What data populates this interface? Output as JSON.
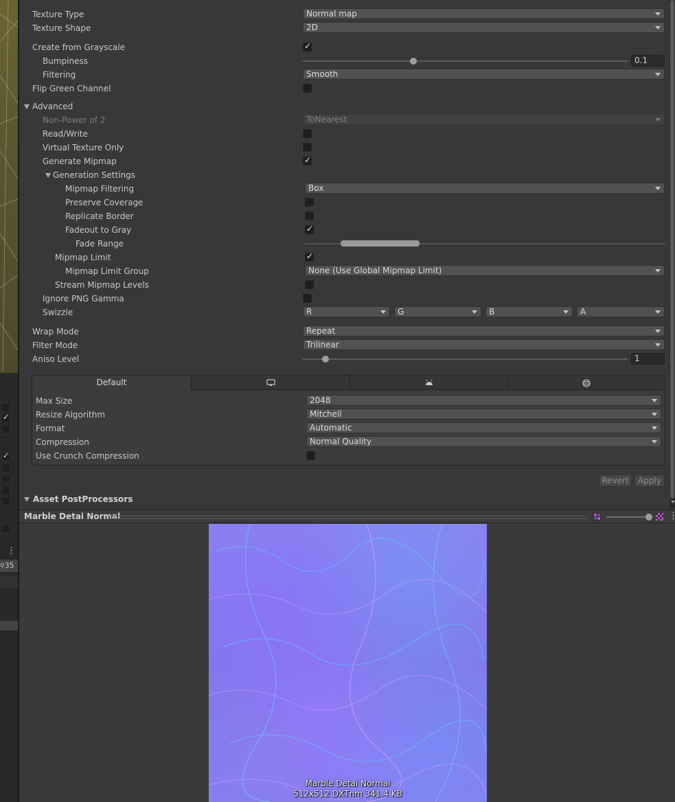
{
  "left_strip": {
    "toggles": [
      false,
      true,
      false,
      true,
      false,
      false,
      false,
      false,
      false
    ],
    "menu_icon": "kebab-menu-icon",
    "counter": "35"
  },
  "inspector": {
    "texture_type": {
      "label": "Texture Type",
      "value": "Normal map"
    },
    "texture_shape": {
      "label": "Texture Shape",
      "value": "2D"
    },
    "create_from_grayscale": {
      "label": "Create from Grayscale",
      "checked": true
    },
    "bumpiness": {
      "label": "Bumpiness",
      "value": "0.1",
      "fraction": 0.34
    },
    "filtering": {
      "label": "Filtering",
      "value": "Smooth"
    },
    "flip_green": {
      "label": "Flip Green Channel",
      "checked": false
    },
    "advanced": {
      "label": "Advanced",
      "non_power_of_2": {
        "label": "Non-Power of 2",
        "value": "ToNearest"
      },
      "read_write": {
        "label": "Read/Write",
        "checked": false
      },
      "virtual_texture_only": {
        "label": "Virtual Texture Only",
        "checked": false
      },
      "generate_mipmap": {
        "label": "Generate Mipmap",
        "checked": true
      },
      "generation_settings": {
        "label": "Generation Settings",
        "mipmap_filtering": {
          "label": "Mipmap Filtering",
          "value": "Box"
        },
        "preserve_coverage": {
          "label": "Preserve Coverage",
          "checked": false
        },
        "replicate_border": {
          "label": "Replicate Border",
          "checked": false
        },
        "fadeout_to_gray": {
          "label": "Fadeout to Gray",
          "checked": true
        },
        "fade_range": {
          "label": "Fade Range",
          "min_fraction": 0.1,
          "max_fraction": 0.32
        }
      },
      "mipmap_limit": {
        "label": "Mipmap Limit",
        "checked": true
      },
      "mipmap_limit_group": {
        "label": "Mipmap Limit Group",
        "value": "None (Use Global Mipmap Limit)"
      },
      "stream_mipmap_levels": {
        "label": "Stream Mipmap Levels",
        "checked": false
      },
      "ignore_png_gamma": {
        "label": "Ignore PNG Gamma",
        "checked": false
      },
      "swizzle": {
        "label": "Swizzle",
        "values": [
          "R",
          "G",
          "B",
          "A"
        ]
      }
    },
    "wrap_mode": {
      "label": "Wrap Mode",
      "value": "Repeat"
    },
    "filter_mode": {
      "label": "Filter Mode",
      "value": "Trilinear"
    },
    "aniso_level": {
      "label": "Aniso Level",
      "value": "1",
      "fraction": 0.07
    },
    "platform": {
      "tabs": [
        {
          "label": "Default",
          "icon": null
        },
        {
          "label": "",
          "icon": "monitor-icon"
        },
        {
          "label": "",
          "icon": "android-icon"
        },
        {
          "label": "",
          "icon": "web-globe-icon"
        }
      ],
      "max_size": {
        "label": "Max Size",
        "value": "2048"
      },
      "resize_algorithm": {
        "label": "Resize Algorithm",
        "value": "Mitchell"
      },
      "format": {
        "label": "Format",
        "value": "Automatic"
      },
      "compression": {
        "label": "Compression",
        "value": "Normal Quality"
      },
      "crunch": {
        "label": "Use Crunch Compression",
        "checked": false
      }
    },
    "buttons": {
      "revert": "Revert",
      "apply": "Apply"
    },
    "asset_postprocessors": {
      "label": "Asset PostProcessors"
    }
  },
  "preview": {
    "title": "Marble Detai Normal",
    "mip_fraction": 1.0,
    "caption_name": "Marble Detai Normal",
    "caption_info": "512x512  DXTnm  341.4 KB"
  },
  "colors": {
    "panel_bg": "#383838",
    "normal_map_base": "#8179e8"
  }
}
